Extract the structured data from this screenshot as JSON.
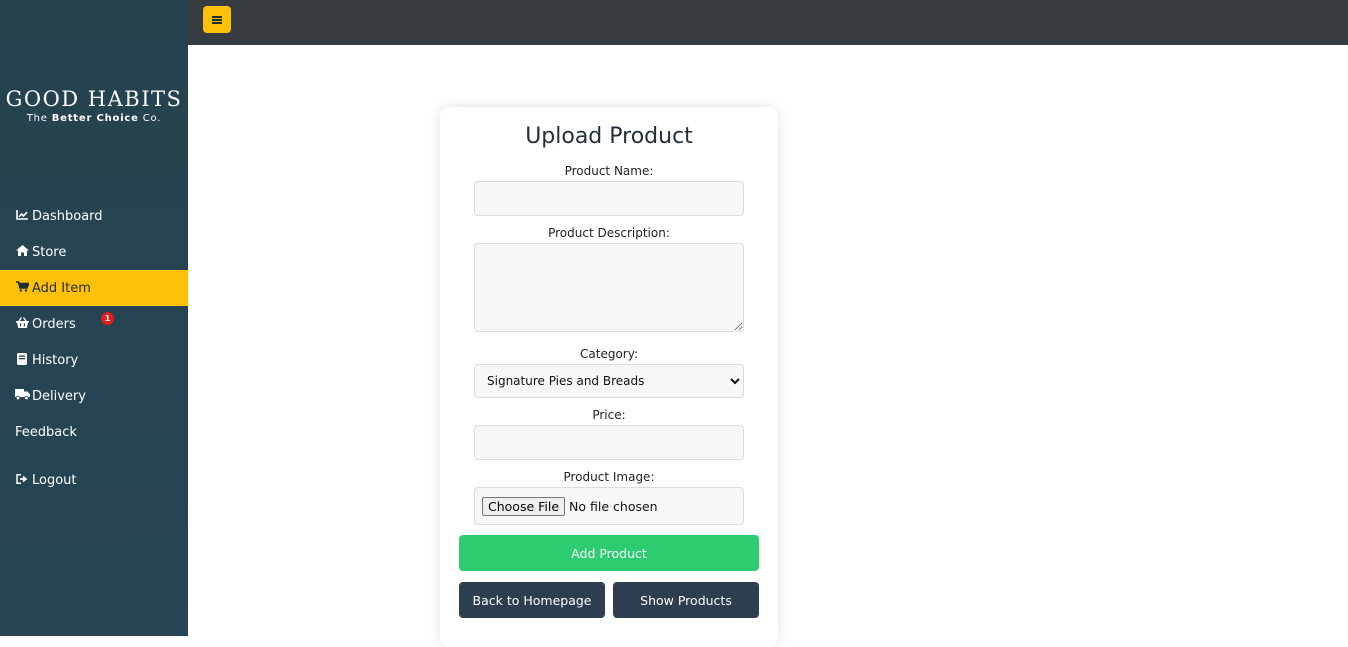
{
  "brand": {
    "name": "GOOD HABITS",
    "tagline_pre": "The",
    "tagline_bold": "Better Choice",
    "tagline_post": "Co."
  },
  "sidebar": {
    "items": [
      {
        "label": "Dashboard",
        "icon": "chart-line-icon"
      },
      {
        "label": "Store",
        "icon": "home-icon"
      },
      {
        "label": "Add Item",
        "icon": "cart-icon",
        "active": true
      },
      {
        "label": "Orders",
        "icon": "basket-icon",
        "badge": "1"
      },
      {
        "label": "History",
        "icon": "book-icon"
      },
      {
        "label": "Delivery",
        "icon": "truck-icon"
      },
      {
        "label": "Feedback",
        "icon": ""
      },
      {
        "label": "Logout",
        "icon": "sign-out-icon"
      }
    ]
  },
  "topbar": {
    "toggle_icon": "hamburger-icon"
  },
  "form": {
    "title": "Upload Product",
    "name_label": "Product Name:",
    "name_value": "",
    "description_label": "Product Description:",
    "description_value": "",
    "category_label": "Category:",
    "category_value": "Signature Pies and Breads",
    "price_label": "Price:",
    "price_value": "",
    "image_label": "Product Image:",
    "choose_file_label": "Choose File",
    "no_file_text": "No file chosen",
    "add_button": "Add Product",
    "back_button": "Back to Homepage",
    "show_button": "Show Products"
  },
  "colors": {
    "sidebar": "#25424f",
    "accent": "#ffc107",
    "topbar": "#373c41",
    "add": "#2ecc71",
    "dark_button": "#2c3e50",
    "badge": "#dc1f1f"
  }
}
